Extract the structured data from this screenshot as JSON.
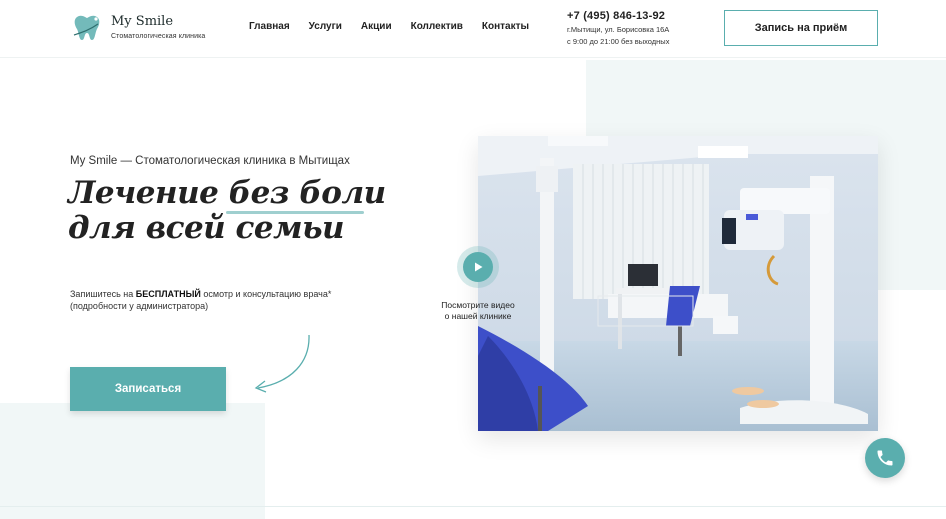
{
  "header": {
    "logo": {
      "name": "My Smile",
      "subtitle": "Стоматологическая клиника"
    },
    "nav": [
      {
        "label": "Главная"
      },
      {
        "label": "Услуги"
      },
      {
        "label": "Акции"
      },
      {
        "label": "Коллектив"
      },
      {
        "label": "Контакты"
      }
    ],
    "contacts": {
      "phone": "+7 (495) 846-13-92",
      "address": "г.Мытищи, ул. Борисовка 16А",
      "hours": "с 9:00 до 21:00 без выходных"
    },
    "appointment_button": "Запись на приём"
  },
  "hero": {
    "eyebrow": "My Smile — Стоматологическая клиника в Мытищах",
    "title_part1": "Лечение ",
    "title_highlight": "без боли",
    "title_line2": "для всей семьи",
    "desc_prefix": "Запишитесь на ",
    "desc_bold": "БЕСПЛАТНЫЙ",
    "desc_suffix": " осмотр и консультацию врача*",
    "desc_note": "(подробности у администратора)",
    "signup_button": "Записаться"
  },
  "video": {
    "caption_line1": "Посмотрите видео",
    "caption_line2": "о нашей клинике"
  },
  "icons": {
    "logo": "tooth-icon",
    "play": "play-icon",
    "call": "phone-icon",
    "arrow": "curved-arrow-icon"
  },
  "colors": {
    "accent": "#5aaeae",
    "accent_light": "#9fcfcf",
    "background_tint": "#f1f7f7",
    "text": "#222222"
  }
}
